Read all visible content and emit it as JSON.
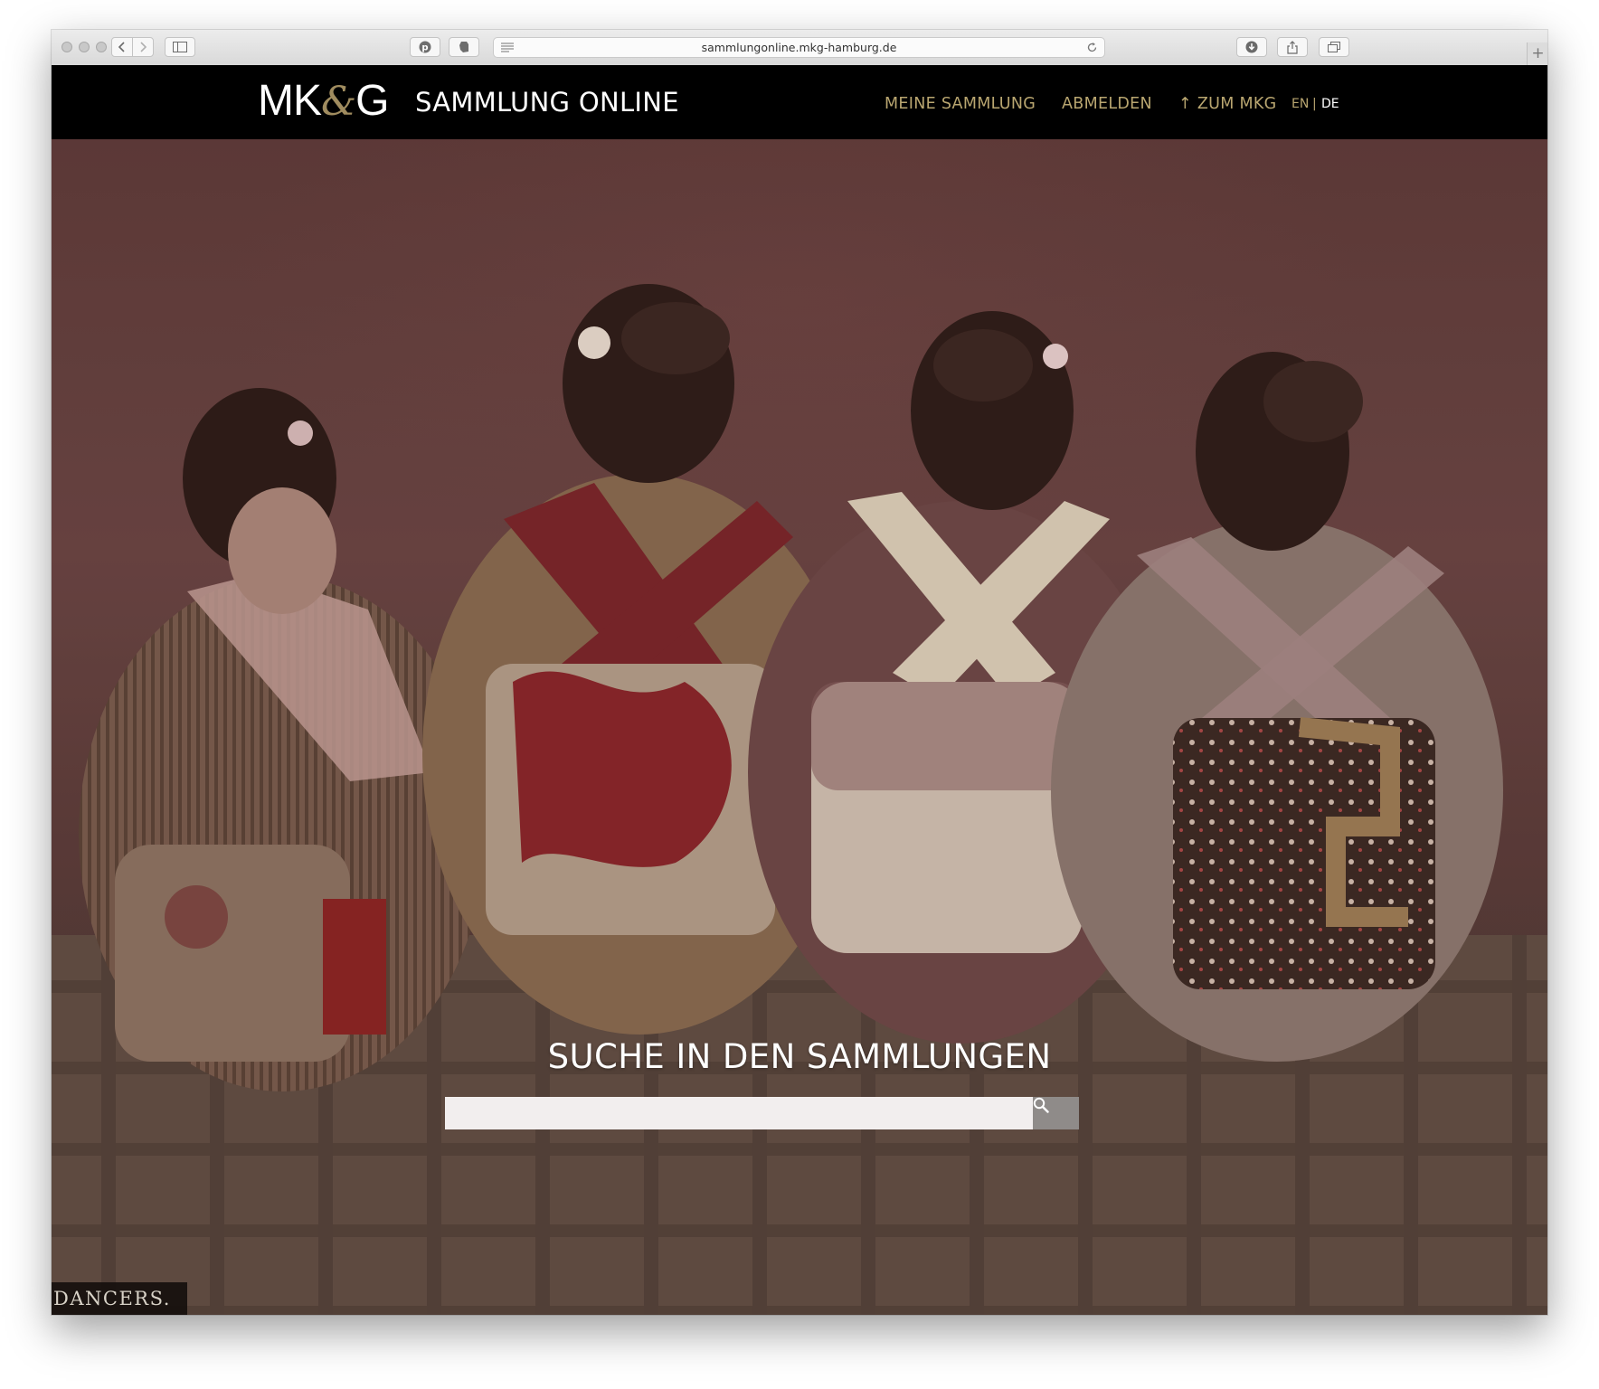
{
  "browser": {
    "url": "sammlungonline.mkg-hamburg.de",
    "new_tab_label": "+"
  },
  "site": {
    "logo_left": "MK",
    "logo_amp": "&",
    "logo_right": "G",
    "title": "SAMMLUNG ONLINE",
    "nav": {
      "meine_sammlung": "MEINE SAMMLUNG",
      "abmelden": "ABMELDEN",
      "zum_mkg_arrow": "↑",
      "zum_mkg": "ZUM MKG"
    },
    "lang": {
      "en": "EN",
      "divider": "|",
      "de": "DE",
      "active": "DE"
    }
  },
  "hero": {
    "search_heading": "SUCHE IN DEN SAMMLUNGEN",
    "search_placeholder": "",
    "caption": "DANCERS."
  },
  "colors": {
    "header_bg": "#000000",
    "nav_gold": "#b9a670",
    "logo_amp": "#a08c5f",
    "search_button": "#8f8b89"
  },
  "icons": {
    "search": "magnifier-icon",
    "back": "chevron-left-icon",
    "forward": "chevron-right-icon",
    "sidebar": "sidebar-icon",
    "pinterest": "pinterest-icon",
    "evernote": "evernote-icon",
    "reader": "reader-icon",
    "reload": "reload-icon",
    "download": "download-icon",
    "share": "share-icon",
    "tabs": "tabs-overview-icon"
  }
}
